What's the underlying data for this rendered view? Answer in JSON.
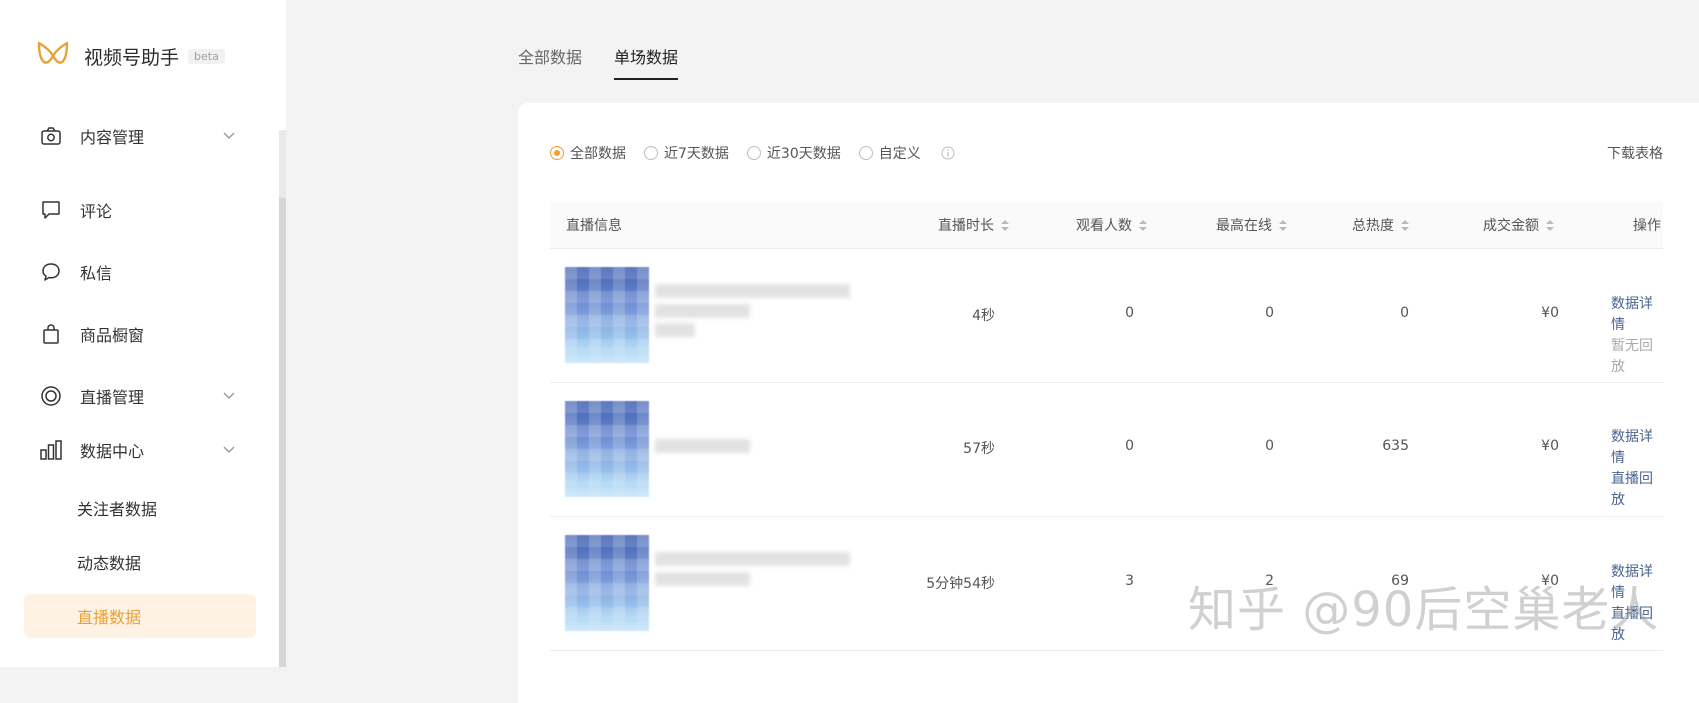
{
  "app": {
    "title": "视频号助手",
    "badge": "beta",
    "accent": "#e8a13b"
  },
  "sidebar": {
    "items": [
      {
        "label": "内容管理",
        "icon": "camera-icon",
        "expandable": true
      },
      {
        "label": "评论",
        "icon": "comment-icon",
        "expandable": false
      },
      {
        "label": "私信",
        "icon": "message-icon",
        "expandable": false
      },
      {
        "label": "商品橱窗",
        "icon": "shopping-bag-icon",
        "expandable": false
      },
      {
        "label": "直播管理",
        "icon": "live-icon",
        "expandable": true
      },
      {
        "label": "数据中心",
        "icon": "chart-icon",
        "expandable": true
      }
    ],
    "sub_items": [
      {
        "label": "关注者数据",
        "active": false
      },
      {
        "label": "动态数据",
        "active": false
      },
      {
        "label": "直播数据",
        "active": true
      }
    ]
  },
  "tabs": [
    {
      "label": "全部数据",
      "active": false
    },
    {
      "label": "单场数据",
      "active": true
    }
  ],
  "filters": {
    "options": [
      {
        "label": "全部数据",
        "checked": true
      },
      {
        "label": "近7天数据",
        "checked": false
      },
      {
        "label": "近30天数据",
        "checked": false
      },
      {
        "label": "自定义",
        "checked": false
      }
    ],
    "download_label": "下载表格"
  },
  "table": {
    "columns": [
      "直播信息",
      "直播时长",
      "观看人数",
      "最高在线",
      "总热度",
      "成交金额",
      "操作"
    ],
    "rows": [
      {
        "duration": "4秒",
        "viewers": "0",
        "peak_online": "0",
        "heat": "0",
        "sales": "¥0",
        "action_primary": "数据详情",
        "action_secondary": "暂无回放",
        "secondary_enabled": false
      },
      {
        "duration": "57秒",
        "viewers": "0",
        "peak_online": "0",
        "heat": "635",
        "sales": "¥0",
        "action_primary": "数据详情",
        "action_secondary": "直播回放",
        "secondary_enabled": true
      },
      {
        "duration": "5分钟54秒",
        "viewers": "3",
        "peak_online": "2",
        "heat": "69",
        "sales": "¥0",
        "action_primary": "数据详情",
        "action_secondary": "直播回放",
        "secondary_enabled": true
      }
    ]
  },
  "watermark": "知乎 @90后空巢老人"
}
